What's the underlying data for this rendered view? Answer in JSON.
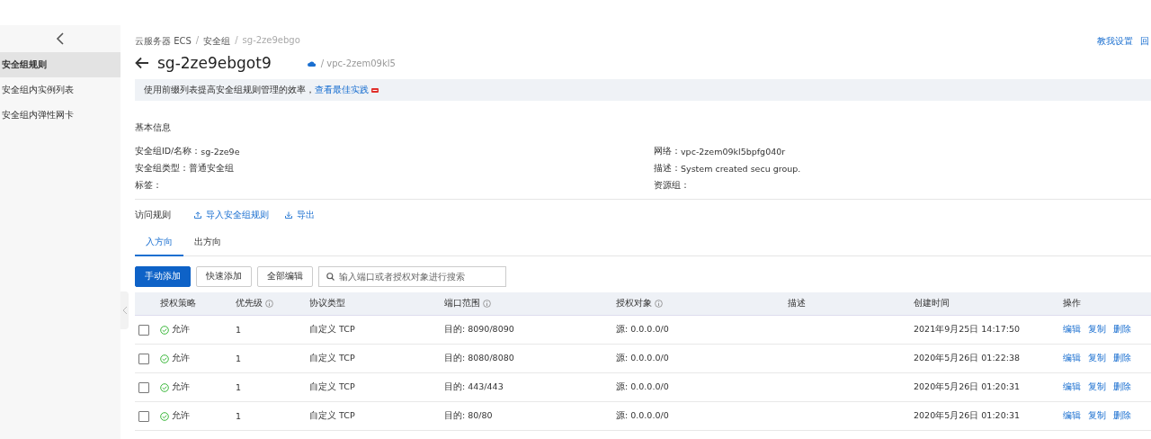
{
  "sidebar": {
    "items": [
      {
        "label": "安全组规则",
        "selected": true
      },
      {
        "label": "安全组内实例列表",
        "selected": false
      },
      {
        "label": "安全组内弹性网卡",
        "selected": false
      }
    ]
  },
  "breadcrumb": {
    "separator": "/",
    "items": [
      "云服务器 ECS",
      "安全组",
      "sg-2ze9ebgo"
    ]
  },
  "top_links": [
    "教我设置",
    "回"
  ],
  "title": "sg-2ze9ebgot9",
  "title_vpc": "/ vpc-2zem09kl5",
  "notice": {
    "text": "使用前缀列表提高安全组规则管理的效率，",
    "link": "查看最佳实践"
  },
  "basic_info": {
    "heading": "基本信息",
    "fields": [
      {
        "label": "安全组ID/名称：",
        "value": "sg-2ze9e"
      },
      {
        "label": "网络：",
        "value": "vpc-2zem09kl5bpfg040r"
      },
      {
        "label": "安全组类型：",
        "value": "普通安全组"
      },
      {
        "label": "描述：",
        "value": "System created secu  group."
      },
      {
        "label": "标签："
      },
      {
        "label": "资源组："
      }
    ]
  },
  "rules_header": {
    "title": "访问规则",
    "actions": [
      "导入安全组规则",
      "导出"
    ]
  },
  "tabs": [
    {
      "label": "入方向",
      "selected": true
    },
    {
      "label": "出方向",
      "selected": false
    }
  ],
  "toolbar": {
    "buttons": [
      {
        "label": "手动添加",
        "kind": "primary"
      },
      {
        "label": "快速添加",
        "kind": "default"
      },
      {
        "label": "全部编辑",
        "kind": "default"
      }
    ],
    "search": {
      "placeholder": "输入端口或者授权对象进行搜索"
    }
  },
  "table": {
    "columns": [
      {
        "label": "授权策略",
        "kind": "plain"
      },
      {
        "label": "优先级",
        "kind": "info"
      },
      {
        "label": "协议类型",
        "kind": "plain"
      },
      {
        "label": "端口范围",
        "kind": "info"
      },
      {
        "label": "授权对象",
        "kind": "info"
      },
      {
        "label": "描述",
        "kind": "plain"
      },
      {
        "label": "创建时间",
        "kind": "plain"
      },
      {
        "label": "操作",
        "kind": "plain"
      }
    ],
    "rows": [
      {
        "checked": false,
        "policy": "允许",
        "priority": "1",
        "protocol": "自定义 TCP",
        "port": "目的: 8090/8090",
        "object": "源: 0.0.0.0/0",
        "created": "2021年9月25日 14:17:50",
        "actions": [
          "编辑",
          "复制",
          "删除"
        ]
      },
      {
        "checked": false,
        "policy": "允许",
        "priority": "1",
        "protocol": "自定义 TCP",
        "port": "目的: 8080/8080",
        "object": "源: 0.0.0.0/0",
        "created": "2020年5月26日 01:22:38",
        "actions": [
          "编辑",
          "复制",
          "删除"
        ]
      },
      {
        "checked": false,
        "policy": "允许",
        "priority": "1",
        "protocol": "自定义 TCP",
        "port": "目的: 443/443",
        "object": "源: 0.0.0.0/0",
        "created": "2020年5月26日 01:20:31",
        "actions": [
          "编辑",
          "复制",
          "删除"
        ]
      },
      {
        "checked": false,
        "policy": "允许",
        "priority": "1",
        "protocol": "自定义 TCP",
        "port": "目的: 80/80",
        "object": "源: 0.0.0.0/0",
        "created": "2020年5月26日 01:20:31",
        "actions": [
          "编辑",
          "复制",
          "删除"
        ]
      }
    ]
  }
}
